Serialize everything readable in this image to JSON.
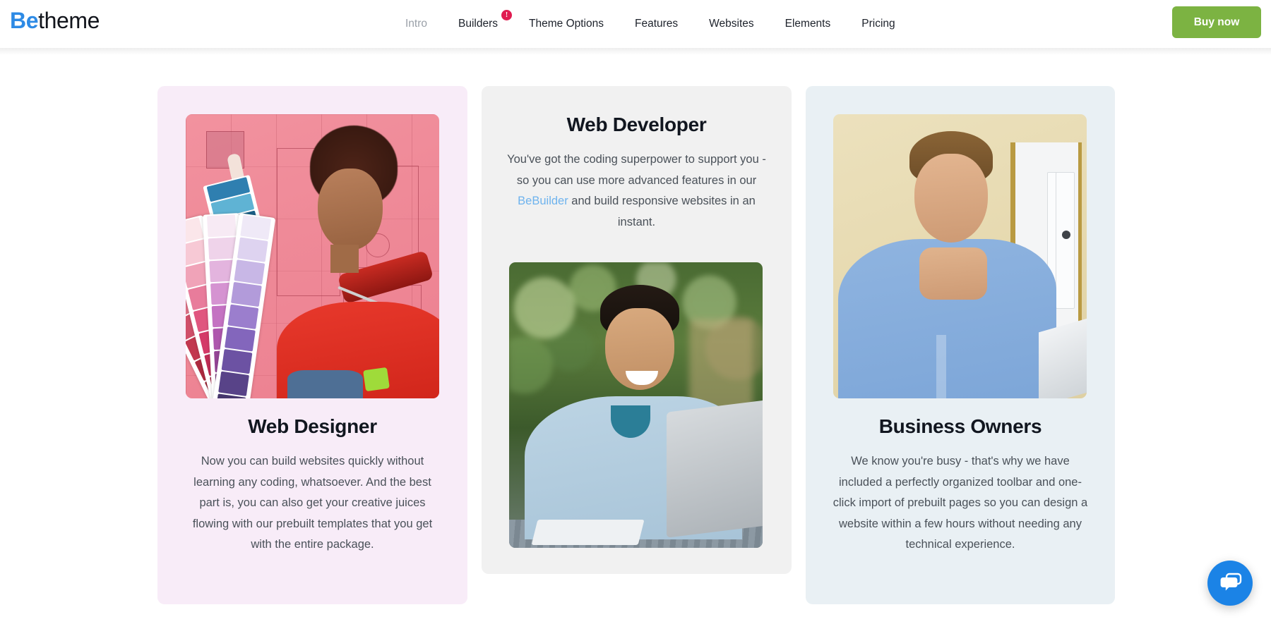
{
  "header": {
    "logo": {
      "bold_part": "Be",
      "light_part": "theme"
    },
    "nav_items": [
      {
        "label": "Intro",
        "state": "muted",
        "badge": null
      },
      {
        "label": "Builders",
        "state": "normal",
        "badge": "!"
      },
      {
        "label": "Theme Options",
        "state": "normal",
        "badge": null
      },
      {
        "label": "Features",
        "state": "normal",
        "badge": null
      },
      {
        "label": "Websites",
        "state": "normal",
        "badge": null
      },
      {
        "label": "Elements",
        "state": "normal",
        "badge": null
      },
      {
        "label": "Pricing",
        "state": "normal",
        "badge": null
      }
    ],
    "cta": {
      "label": "Buy now",
      "color": "#7cb342"
    },
    "badge_color": "#e01b50",
    "logo_accent_color": "#2d8ae5"
  },
  "cards": [
    {
      "id": "web-designer",
      "title": "Web Designer",
      "body_before_link": "Now you can build websites quickly without learning any coding, whatsoever. And the best part is, you can also get your creative juices flowing with our prebuilt templates that you get with the entire package.",
      "link_label": "",
      "body_after_link": "",
      "background": "#f8ecf8",
      "image_alt": "woman holding colour swatch fans in front of a pink blueprint wall"
    },
    {
      "id": "web-developer",
      "title": "Web Developer",
      "body_before_link": "You've got the coding superpower to support you - so you can use more advanced features in our ",
      "link_label": "BeBuilder",
      "body_after_link": " and build responsive websites in an instant.",
      "background": "#f1f1f1",
      "link_color": "#6eb3ee",
      "image_alt": "smiling man working on a laptop outdoors"
    },
    {
      "id": "business-owners",
      "title": "Business Owners",
      "body_before_link": "We know you're busy - that's why we have included a perfectly organized toolbar and one-click import of prebuilt pages so you can design a website within a few hours without needing any technical experience.",
      "link_label": "",
      "body_after_link": "",
      "background": "#e9f0f4",
      "image_alt": "businessman in a blue shirt resting chin on hands in an office"
    }
  ],
  "chat_widget": {
    "icon": "chat-bubbles-icon",
    "color": "#1b83e6"
  }
}
